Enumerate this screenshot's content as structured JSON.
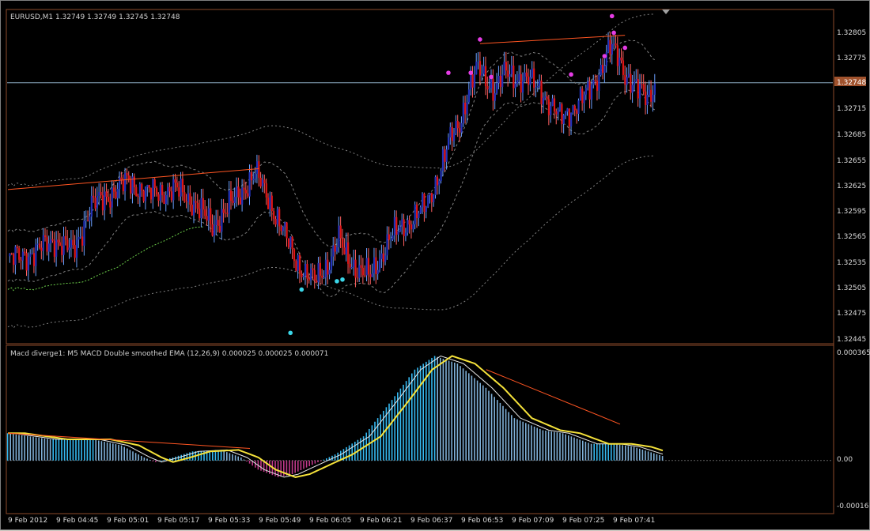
{
  "window": {
    "symbol_line": "EURUSD,M1  1.32749 1.32749 1.32745 1.32748",
    "indicator_line": "Macd diverge1:  M5 MACD Double smoothed EMA (12,26,9) 0.000025 0.000025 0.000071"
  },
  "price_axis": {
    "labels": [
      "1.32805",
      "1.32775",
      "1.32745",
      "1.32715",
      "1.32685",
      "1.32655",
      "1.32625",
      "1.32595",
      "1.32565",
      "1.32535",
      "1.32505",
      "1.32475",
      "1.32445"
    ],
    "current_price": "1.32748"
  },
  "macd_axis": {
    "labels": [
      "0.000365",
      "0.00",
      "-0.00016"
    ]
  },
  "time_axis": {
    "labels": [
      "9 Feb 2012",
      "9 Feb 04:45",
      "9 Feb 05:01",
      "9 Feb 05:17",
      "9 Feb 05:33",
      "9 Feb 05:49",
      "9 Feb 06:05",
      "9 Feb 06:21",
      "9 Feb 06:37",
      "9 Feb 06:53",
      "9 Feb 07:09",
      "9 Feb 07:25",
      "9 Feb 07:41"
    ]
  },
  "colors": {
    "background": "#000000",
    "grid_border": "#8c4a2a",
    "bull": "#2233bb",
    "bear": "#e01515",
    "macd_up": "#35b8f0",
    "macd_down": "#c03a8a",
    "signal": "#f5e23a",
    "trendline": "#ff5522",
    "envelope": "#808080",
    "current_price_line": "#8fb0c8",
    "top_dot": "#e53ce5",
    "bottom_dot": "#3ad6e8",
    "axis_text": "#d9d9d9",
    "current_price_box": "#a0522d"
  },
  "chart_data": {
    "type": "candlestick",
    "price_range": [
      1.32435,
      1.32835
    ],
    "anchors": [
      [
        0,
        1.32535
      ],
      [
        15,
        1.32545
      ],
      [
        25,
        1.3256
      ],
      [
        35,
        1.32545
      ],
      [
        45,
        1.326
      ],
      [
        55,
        1.32615
      ],
      [
        65,
        1.3263
      ],
      [
        75,
        1.32615
      ],
      [
        90,
        1.3262
      ],
      [
        100,
        1.32605
      ],
      [
        110,
        1.32575
      ],
      [
        115,
        1.3259
      ],
      [
        125,
        1.32615
      ],
      [
        133,
        1.3264
      ],
      [
        140,
        1.3261
      ],
      [
        148,
        1.3257
      ],
      [
        155,
        1.32535
      ],
      [
        160,
        1.3252
      ],
      [
        165,
        1.3251
      ],
      [
        172,
        1.3253
      ],
      [
        178,
        1.3256
      ],
      [
        182,
        1.3254
      ],
      [
        188,
        1.32525
      ],
      [
        195,
        1.32515
      ],
      [
        205,
        1.3256
      ],
      [
        215,
        1.3258
      ],
      [
        225,
        1.326
      ],
      [
        232,
        1.3264
      ],
      [
        238,
        1.3268
      ],
      [
        243,
        1.327
      ],
      [
        248,
        1.3274
      ],
      [
        253,
        1.32765
      ],
      [
        258,
        1.3275
      ],
      [
        262,
        1.3274
      ],
      [
        268,
        1.3276
      ],
      [
        273,
        1.32755
      ],
      [
        280,
        1.3275
      ],
      [
        287,
        1.3274
      ],
      [
        292,
        1.3272
      ],
      [
        297,
        1.32705
      ],
      [
        305,
        1.3272
      ],
      [
        312,
        1.32735
      ],
      [
        318,
        1.3276
      ],
      [
        324,
        1.3279
      ],
      [
        328,
        1.3278
      ],
      [
        332,
        1.3276
      ],
      [
        338,
        1.3274
      ],
      [
        344,
        1.3273
      ],
      [
        348,
        1.32748
      ]
    ],
    "macd_range": [
      -0.00017,
      0.000375
    ],
    "macd_anchors": [
      [
        0,
        9e-05
      ],
      [
        15,
        7e-05
      ],
      [
        30,
        7e-05
      ],
      [
        40,
        5e-05
      ],
      [
        48,
        1e-05
      ],
      [
        52,
        -5e-06
      ],
      [
        58,
        1e-05
      ],
      [
        65,
        3e-05
      ],
      [
        75,
        3.5e-05
      ],
      [
        82,
        1e-05
      ],
      [
        88,
        -3e-05
      ],
      [
        95,
        -5.5e-05
      ],
      [
        100,
        -4.5e-05
      ],
      [
        108,
        -1e-05
      ],
      [
        115,
        2e-05
      ],
      [
        125,
        8e-05
      ],
      [
        135,
        0.0002
      ],
      [
        143,
        0.0003
      ],
      [
        150,
        0.000345
      ],
      [
        158,
        0.00032
      ],
      [
        168,
        0.00024
      ],
      [
        178,
        0.00014
      ],
      [
        188,
        0.0001
      ],
      [
        195,
        9e-05
      ],
      [
        205,
        5.5e-05
      ],
      [
        213,
        5.5e-05
      ],
      [
        220,
        4.5e-05
      ],
      [
        230,
        1.5e-05
      ]
    ],
    "top_dots": [
      1.328,
      1.32745,
      1.3274
    ],
    "bottom_dots": [
      1.325,
      1.32448,
      1.3251,
      1.32512
    ]
  }
}
